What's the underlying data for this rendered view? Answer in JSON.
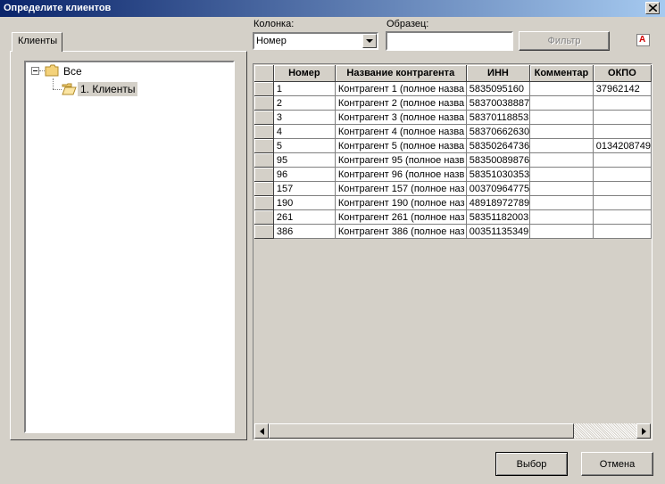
{
  "window": {
    "title": "Определите клиентов"
  },
  "left_tab": {
    "label": "Клиенты"
  },
  "tree": {
    "root": {
      "label": "Все"
    },
    "child": {
      "label": "1. Клиенты"
    }
  },
  "filter": {
    "column_label": "Колонка:",
    "column_value": "Номер",
    "sample_label": "Образец:",
    "sample_value": "",
    "filter_button": "Фильтр",
    "clear_icon_letter": "A"
  },
  "table": {
    "columns": [
      "Номер",
      "Название контрагента",
      "ИНН",
      "Комментар",
      "ОКПО"
    ],
    "rows": [
      [
        "1",
        "Контрагент 1 (полное назва",
        "5835095160",
        "",
        "37962142"
      ],
      [
        "2",
        "Контрагент 2 (полное назва",
        "58370038887",
        "",
        ""
      ],
      [
        "3",
        "Контрагент 3 (полное назва",
        "58370118853",
        "",
        ""
      ],
      [
        "4",
        "Контрагент 4 (полное назва",
        "58370662630",
        "",
        ""
      ],
      [
        "5",
        "Контрагент 5 (полное назва",
        "58350264736",
        "",
        "0134208749"
      ],
      [
        "95",
        "Контрагент 95 (полное назв",
        "58350089876",
        "",
        ""
      ],
      [
        "96",
        "Контрагент 96 (полное назв",
        "58351030353",
        "",
        ""
      ],
      [
        "157",
        "Контрагент 157 (полное наз",
        "00370964775",
        "",
        ""
      ],
      [
        "190",
        "Контрагент 190 (полное наз",
        "48918972789",
        "",
        ""
      ],
      [
        "261",
        "Контрагент 261 (полное наз",
        "58351182003",
        "",
        ""
      ],
      [
        "386",
        "Контрагент 386 (полное наз",
        "00351135349",
        "",
        ""
      ]
    ]
  },
  "buttons": {
    "select": "Выбор",
    "cancel": "Отмена"
  },
  "colors": {
    "title_start": "#0a246a",
    "title_end": "#a6caf0",
    "face": "#d4d0c8",
    "accent_red": "#d00000"
  },
  "icons": [
    "close-icon",
    "folder-icon",
    "folder-open-icon",
    "chevron-down-icon",
    "arrow-left-icon",
    "arrow-right-icon"
  ]
}
